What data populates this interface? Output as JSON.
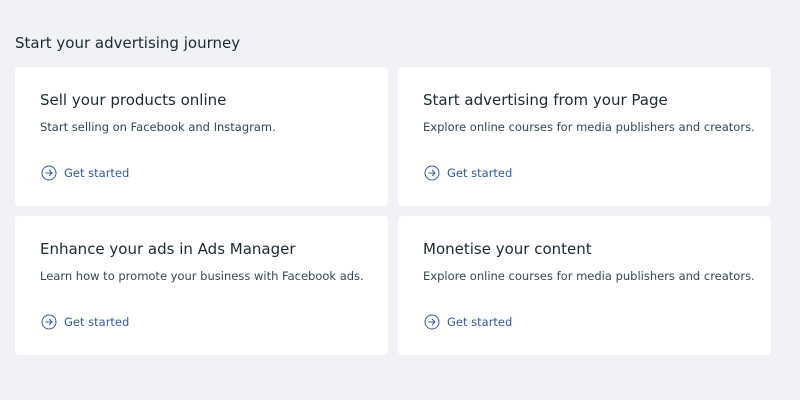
{
  "section": {
    "title": "Start your advertising journey"
  },
  "cards": [
    {
      "title": "Sell your products online",
      "description": "Start selling on Facebook and Instagram.",
      "cta_label": "Get started"
    },
    {
      "title": "Start advertising from your Page",
      "description": "Explore online courses for media publishers and creators.",
      "cta_label": "Get started"
    },
    {
      "title": "Enhance your ads in Ads Manager",
      "description": "Learn how to promote your business with Facebook ads.",
      "cta_label": "Get started"
    },
    {
      "title": "Monetise your content",
      "description": "Explore online courses for media publishers and creators.",
      "cta_label": "Get started"
    }
  ],
  "icons": {
    "cta_icon": "arrow-right-circle-icon"
  },
  "colors": {
    "page_background": "#f0f2f5",
    "card_background": "#ffffff",
    "link": "#385898",
    "title_text": "#1c2b33",
    "body_text": "#344854"
  }
}
